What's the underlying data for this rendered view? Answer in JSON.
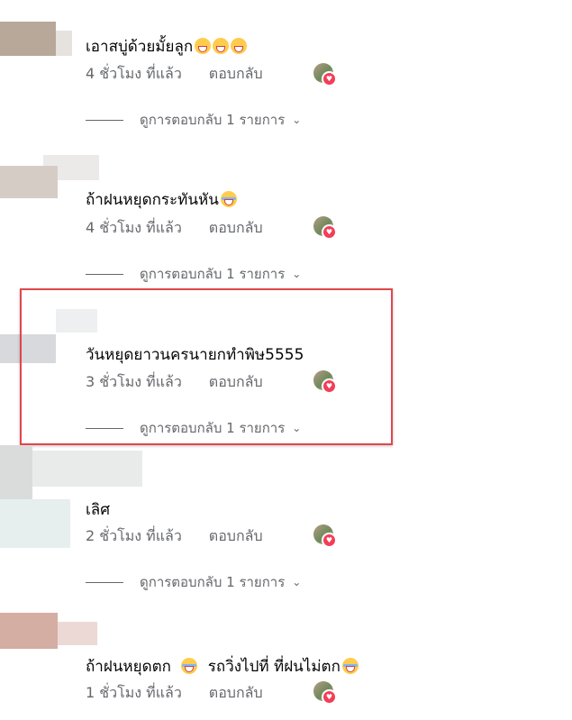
{
  "comments": [
    {
      "text": "เอาสบู่ด้วยมั้ยลูก",
      "emojis": [
        "grin",
        "grin",
        "grin"
      ],
      "time": "4 ชั่วโมง ที่แล้ว",
      "reply": "ตอบกลับ",
      "view_replies": "ดูการตอบกลับ 1 รายการ",
      "avatar_colors": [
        "#b8a89a",
        "#e6e2de"
      ]
    },
    {
      "text": "ถ้าฝนหยุดกระทันหัน",
      "emojis": [
        "laugh"
      ],
      "time": "4 ชั่วโมง ที่แล้ว",
      "reply": "ตอบกลับ",
      "view_replies": "ดูการตอบกลับ 1 รายการ",
      "avatar_colors": [
        "#d6ccc6",
        "#eceae8"
      ]
    },
    {
      "text": "วันหยุดยาวนครนายกทำพิษ5555",
      "emojis": [],
      "time": "3 ชั่วโมง ที่แล้ว",
      "reply": "ตอบกลับ",
      "view_replies": "ดูการตอบกลับ 1 รายการ",
      "avatar_colors": [
        "#d7d9dc",
        "#eeeff0"
      ]
    },
    {
      "text": "เลิศ",
      "emojis": [],
      "time": "2 ชั่วโมง ที่แล้ว",
      "reply": "ตอบกลับ",
      "view_replies": "ดูการตอบกลับ 1 รายการ",
      "avatar_colors": [
        "#dfe3e3",
        "#e6eeee"
      ]
    },
    {
      "text": "ถ้าฝนหยุดตก",
      "text2": "รถวิ่งไปที่ ที่ฝนไม่ตก",
      "emojis": [
        "laugh"
      ],
      "time": "1 ชั่วโมง ที่แล้ว",
      "reply": "ตอบกลับ",
      "avatar_colors": [
        "#d4aea3",
        "#ecd9d5"
      ]
    }
  ],
  "colors": {
    "highlight": "#e0474c",
    "meta": "#65676b",
    "heart": "#f33e58"
  },
  "icons": [
    "chevron-down-icon",
    "reaction-heart-icon",
    "grin-emoji-icon",
    "laugh-emoji-icon"
  ]
}
